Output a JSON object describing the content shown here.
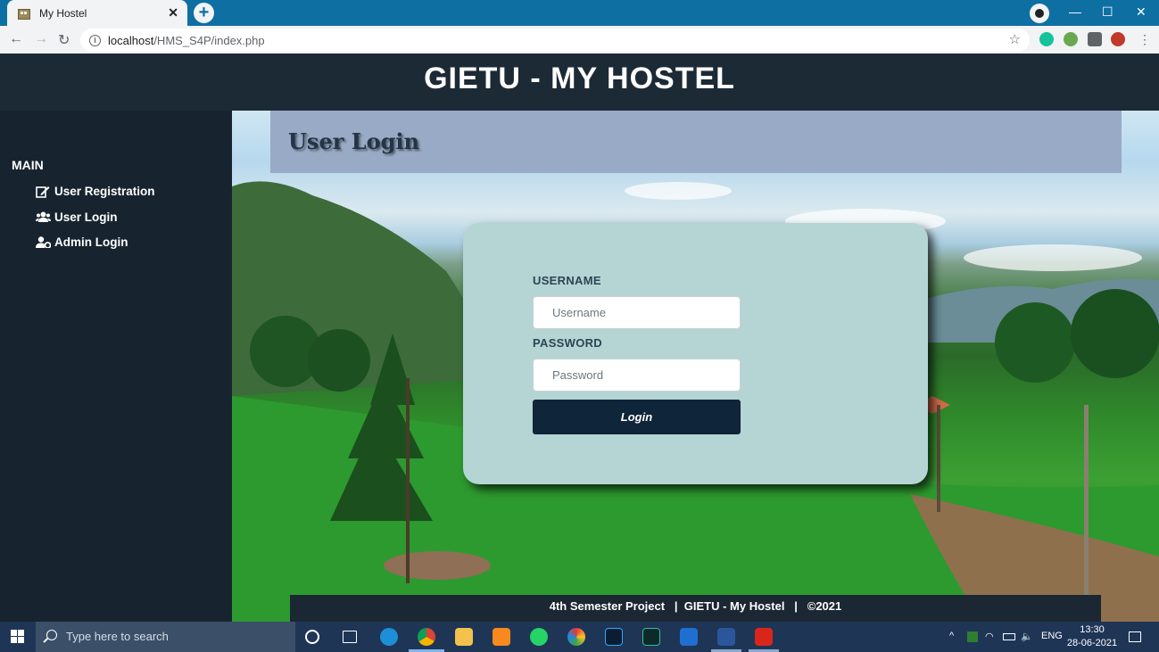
{
  "browser": {
    "tab_title": "My Hostel",
    "url_host": "localhost",
    "url_path": "/HMS_S4P/index.php"
  },
  "header": {
    "title": "GIETU - MY HOSTEL"
  },
  "sidebar": {
    "section_label": "MAIN",
    "items": [
      {
        "label": "User Registration",
        "icon": "edit-icon"
      },
      {
        "label": "User Login",
        "icon": "users-icon"
      },
      {
        "label": "Admin Login",
        "icon": "user-cog-icon"
      }
    ]
  },
  "banner": {
    "title": "User Login"
  },
  "login_form": {
    "username_label": "USERNAME",
    "username_placeholder": "Username",
    "password_label": "PASSWORD",
    "password_placeholder": "Password",
    "submit_label": "Login"
  },
  "footer": {
    "text": "4th Semester Project   |  GIETU - My Hostel   |   ©2021"
  },
  "taskbar": {
    "search_placeholder": "Type here to search",
    "language": "ENG",
    "time": "13:30",
    "date": "28-06-2021"
  },
  "colors": {
    "header_bg": "#1c2a36",
    "sidebar_bg": "#172430",
    "banner_bg": "#98aac5",
    "card_bg": "#b5d5d4",
    "button_bg": "#0f2539"
  }
}
